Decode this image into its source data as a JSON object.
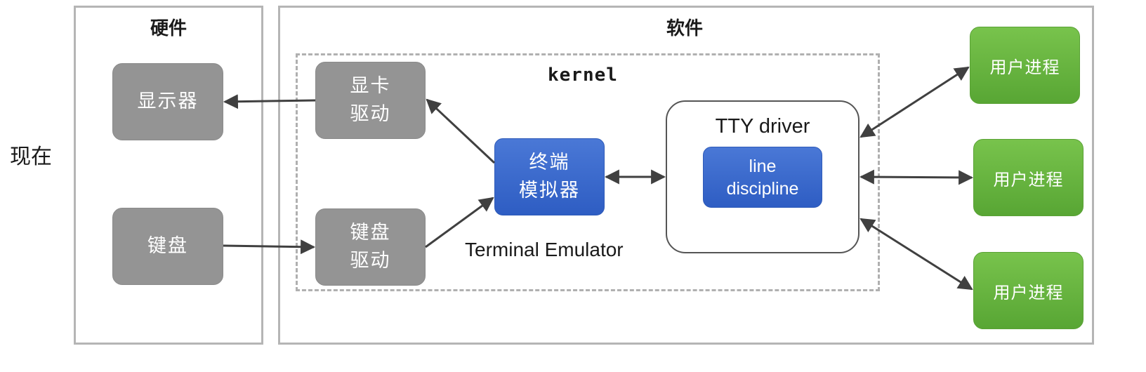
{
  "side_label": "现在",
  "hardware": {
    "title": "硬件",
    "display": "显示器",
    "keyboard": "键盘"
  },
  "software": {
    "title": "软件",
    "kernel_label": "kernel",
    "display_driver": [
      "显卡",
      "驱动"
    ],
    "keyboard_driver": [
      "键盘",
      "驱动"
    ],
    "terminal_emulator": [
      "终端",
      "模拟器"
    ],
    "terminal_emulator_caption": "Terminal Emulator",
    "tty_driver": "TTY driver",
    "line_discipline": [
      "line",
      "discipline"
    ],
    "user_processes": [
      "用户进程",
      "用户进程",
      "用户进程"
    ]
  },
  "colors": {
    "hardware_box": "#949494",
    "kernel_box": "#3a68cc",
    "user_process_box": "#66b33f",
    "arrow": "#404040"
  }
}
